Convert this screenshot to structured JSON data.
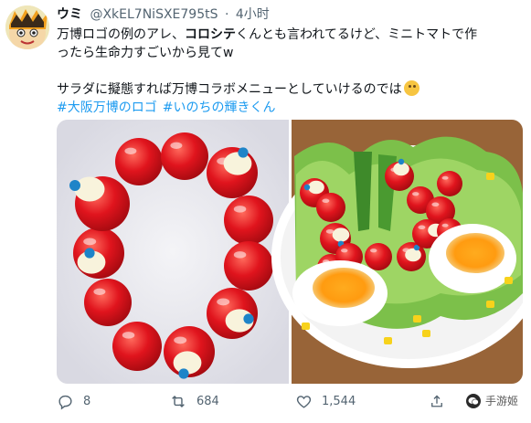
{
  "tweet": {
    "author": {
      "name": "ウミ",
      "handle": "@XkEL7NiSXE795tS",
      "separator": "·",
      "time": "4小时"
    },
    "text": {
      "line1_a": "万博ロゴの例のアレ、",
      "line1_bold": "コロシテ",
      "line1_b": "くんとも言われてるけど、ミニトマトで作",
      "line2": "ったら生命力すごいから見てw",
      "line3": "サラダに擬態すれば万博コラボメニューとしていけるのでは",
      "emoji": "thinking-face"
    },
    "hashtags": [
      "#大阪万博のロゴ",
      "#いのちの輝きくん"
    ],
    "media": {
      "left_alt": "mini-tomato-ring",
      "right_alt": "salad-plate"
    },
    "actions": {
      "reply_count": "8",
      "retweet_count": "684",
      "like_count": "1,544"
    },
    "watermark": "手游姬",
    "colors": {
      "link": "#1d9bf0",
      "tomato": "#d7141e",
      "muted": "#536471"
    }
  }
}
